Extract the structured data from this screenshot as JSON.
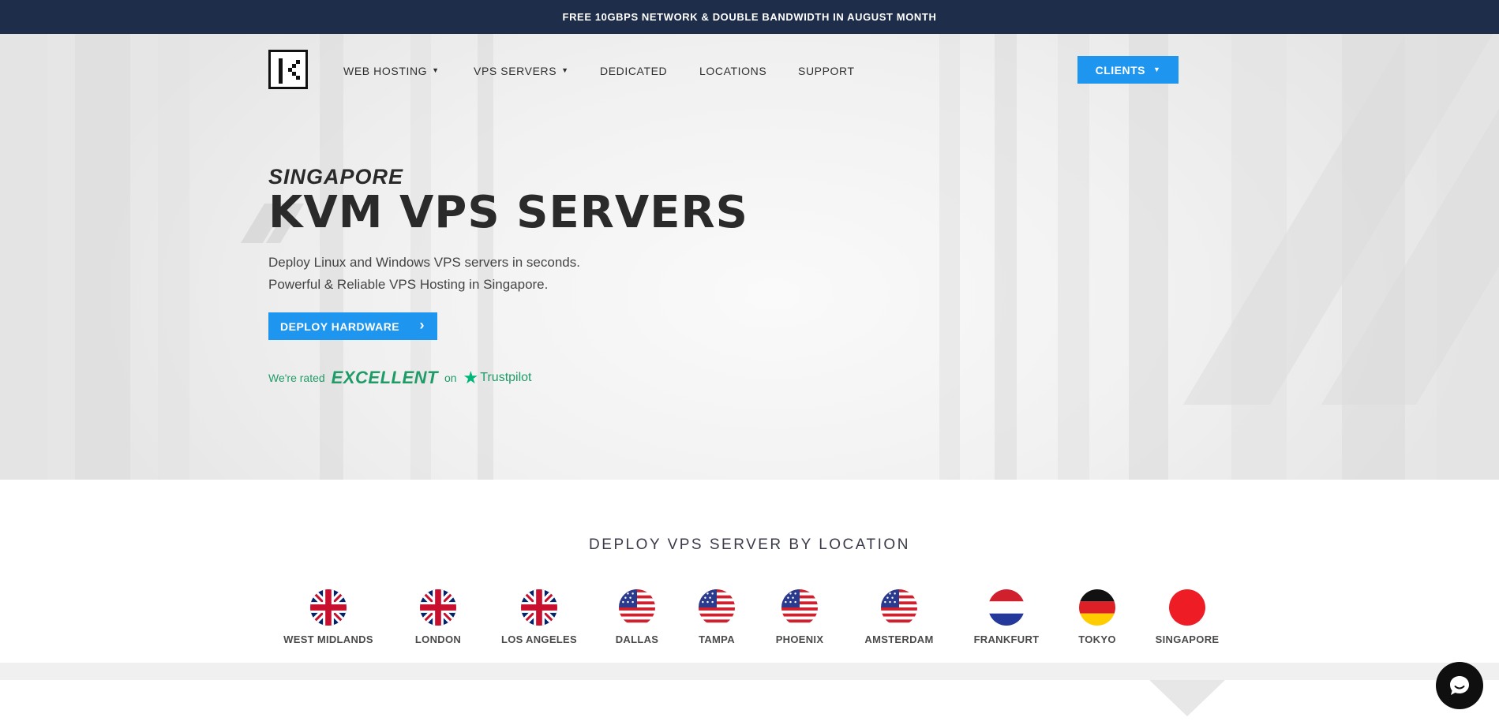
{
  "announcement": "FREE 10GBPS NETWORK & DOUBLE BANDWIDTH IN AUGUST MONTH",
  "nav": {
    "items": [
      {
        "label": "WEB HOSTING",
        "has_dropdown": true
      },
      {
        "label": "VPS SERVERS",
        "has_dropdown": true
      },
      {
        "label": "DEDICATED",
        "has_dropdown": false
      },
      {
        "label": "LOCATIONS",
        "has_dropdown": false
      },
      {
        "label": "SUPPORT",
        "has_dropdown": false
      }
    ],
    "clients_label": "CLIENTS",
    "logo_icon": "k-logo-icon"
  },
  "hero": {
    "kicker": "SINGAPORE",
    "headline": "KVM VPS SERVERS",
    "sub1": "Deploy Linux and Windows VPS servers in seconds.",
    "sub2": "Powerful & Reliable VPS Hosting in Singapore.",
    "cta_label": "DEPLOY HARDWARE",
    "trust": {
      "rated": "We're rated",
      "rating": "EXCELLENT",
      "on": "on",
      "brand": "Trustpilot"
    }
  },
  "locations": {
    "title": "DEPLOY VPS SERVER BY LOCATION",
    "items": [
      {
        "name": "WEST MIDLANDS",
        "flag": "uk"
      },
      {
        "name": "LONDON",
        "flag": "uk"
      },
      {
        "name": "LOS ANGELES",
        "flag": "uk"
      },
      {
        "name": "DALLAS",
        "flag": "us"
      },
      {
        "name": "TAMPA",
        "flag": "us"
      },
      {
        "name": "PHOENIX",
        "flag": "us"
      },
      {
        "name": "AMSTERDAM",
        "flag": "us"
      },
      {
        "name": "FRANKFURT",
        "flag": "nl"
      },
      {
        "name": "TOKYO",
        "flag": "de"
      },
      {
        "name": "SINGAPORE",
        "flag": "jp"
      }
    ]
  },
  "colors": {
    "topbar": "#1e2d4a",
    "accent": "#1e96f0",
    "trustpilot": "#00b67a"
  },
  "chat_icon": "chat-bubble-icon"
}
